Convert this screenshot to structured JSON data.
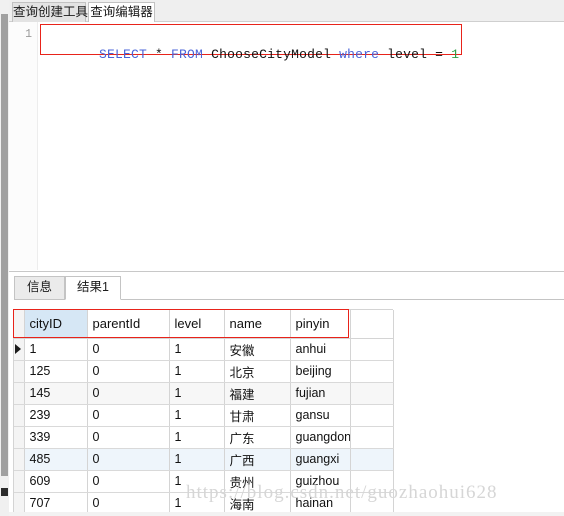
{
  "window": {
    "top_tabs": [
      {
        "label": "查询创建工具",
        "active": false
      },
      {
        "label": "查询编辑器",
        "active": true
      }
    ]
  },
  "editor": {
    "line_number": "1",
    "sql_tokens": [
      {
        "text": "SELECT",
        "kind": "keyword"
      },
      {
        "text": " * ",
        "kind": "operator"
      },
      {
        "text": "FROM",
        "kind": "keyword"
      },
      {
        "text": " ",
        "kind": "operator"
      },
      {
        "text": "ChooseCityModel",
        "kind": "identifier"
      },
      {
        "text": " ",
        "kind": "operator"
      },
      {
        "text": "where",
        "kind": "keyword"
      },
      {
        "text": " ",
        "kind": "operator"
      },
      {
        "text": "level",
        "kind": "identifier"
      },
      {
        "text": " = ",
        "kind": "operator"
      },
      {
        "text": "1",
        "kind": "number"
      }
    ],
    "sql_plain": "SELECT * FROM ChooseCityModel where level = 1",
    "highlight_color": "#e8231a",
    "keyword_color": "#4a63d8",
    "number_color": "#2f9e44"
  },
  "results": {
    "tabs": [
      {
        "label": "信息",
        "active": false
      },
      {
        "label": "结果1",
        "active": true
      }
    ],
    "grid": {
      "columns": [
        "cityID",
        "parentId",
        "level",
        "name",
        "pinyin"
      ],
      "selected_column": "cityID",
      "selected_row_index": 5,
      "current_row_index": 0,
      "rows": [
        [
          "1",
          "0",
          "1",
          "安徽",
          "anhui"
        ],
        [
          "125",
          "0",
          "1",
          "北京",
          "beijing"
        ],
        [
          "145",
          "0",
          "1",
          "福建",
          "fujian"
        ],
        [
          "239",
          "0",
          "1",
          "甘肃",
          "gansu"
        ],
        [
          "339",
          "0",
          "1",
          "广东",
          "guangdong"
        ],
        [
          "485",
          "0",
          "1",
          "广西",
          "guangxi"
        ],
        [
          "609",
          "0",
          "1",
          "贵州",
          "guizhou"
        ],
        [
          "707",
          "0",
          "1",
          "海南",
          "hainan"
        ]
      ]
    }
  },
  "watermark": {
    "text": "https://blog.csdn.net/guozhaohui628"
  }
}
